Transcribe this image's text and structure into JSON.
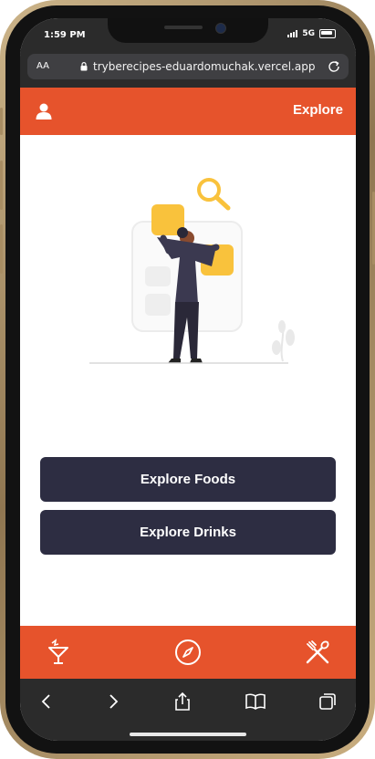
{
  "status_bar": {
    "time": "1:59 PM",
    "network": "5G"
  },
  "browser": {
    "text_size_label": "AA",
    "url": "trybe­recipes-eduardomuchak.vercel.app"
  },
  "header": {
    "title": "Explore",
    "profile_icon": "profile-icon"
  },
  "main": {
    "buttons": [
      {
        "label": "Explore Foods"
      },
      {
        "label": "Explore Drinks"
      }
    ]
  },
  "footer": {
    "icons": [
      "drink-icon",
      "explore-compass-icon",
      "food-icon"
    ]
  },
  "colors": {
    "accent": "#e6532c",
    "button": "#2d2d42",
    "illustration_yellow": "#f9c23c",
    "figure": "#3b3950"
  }
}
